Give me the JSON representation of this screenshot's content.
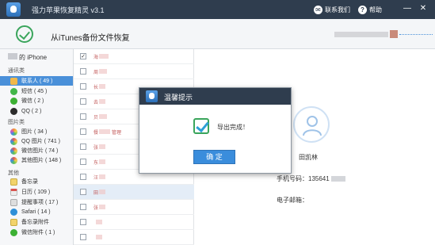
{
  "titlebar": {
    "title": "强力苹果恢复精灵 v3.1",
    "contact_label": "联系我们",
    "help_label": "帮助",
    "minimize": "—",
    "close": "✕"
  },
  "header": {
    "title": "从iTunes备份文件恢复"
  },
  "sidebar": {
    "device_label": "的 iPhone",
    "groups": {
      "contacts": "通讯类",
      "images": "图片类",
      "others": "其他"
    },
    "items": [
      {
        "label": "联系人 ( 49 )",
        "icon": "contacts-icon",
        "color": "#f0b84a"
      },
      {
        "label": "短信 ( 45 )",
        "icon": "sms-icon",
        "color": "#42b648"
      },
      {
        "label": "微信 ( 2 )",
        "icon": "wechat-icon",
        "color": "#3cb034"
      },
      {
        "label": "QQ ( 2 )",
        "icon": "qq-icon",
        "color": "#2b2b2b"
      },
      {
        "label": "图片 ( 34 )",
        "icon": "photos-icon",
        "color": "#f28c38"
      },
      {
        "label": "QQ 图片 ( 741 )",
        "icon": "qq-photos-icon",
        "color": "#e05656"
      },
      {
        "label": "微信图片 ( 74 )",
        "icon": "wechat-photos-icon",
        "color": "#e05656"
      },
      {
        "label": "其他图片 ( 148 )",
        "icon": "other-photos-icon",
        "color": "#e05656"
      },
      {
        "label": "备忘录",
        "icon": "notes-icon",
        "color": "#f2d36b"
      },
      {
        "label": "日历 ( 109 )",
        "icon": "calendar-icon",
        "color": "#ededed"
      },
      {
        "label": "提醒事项 ( 17 )",
        "icon": "reminders-icon",
        "color": "#dedede"
      },
      {
        "label": "Safari ( 14 )",
        "icon": "safari-icon",
        "color": "#2e8fd8"
      },
      {
        "label": "备忘录附件",
        "icon": "notes-attachment-icon",
        "color": "#f2d36b"
      },
      {
        "label": "微信附件 ( 1 )",
        "icon": "wechat-attachment-icon",
        "color": "#3cb034"
      }
    ]
  },
  "list": {
    "rows": [
      {
        "text": "海",
        "checked": "✓"
      },
      {
        "text": "周",
        "checked": ""
      },
      {
        "text": "长",
        "checked": ""
      },
      {
        "text": "去",
        "checked": ""
      },
      {
        "text": "贝",
        "checked": ""
      },
      {
        "text": "餐",
        "checked": ""
      },
      {
        "text": "张",
        "checked": ""
      },
      {
        "text": "东",
        "checked": ""
      },
      {
        "text": "汪",
        "checked": ""
      },
      {
        "text": "田",
        "checked": ""
      },
      {
        "text": "张",
        "checked": ""
      },
      {
        "text": "",
        "checked": ""
      },
      {
        "text": "",
        "checked": ""
      }
    ],
    "row5_suffix": "管理"
  },
  "detail": {
    "name": "田凯林",
    "phone_label": "手机号码：135641",
    "email_label": "电子邮箱："
  },
  "dialog": {
    "title": "温馨提示",
    "message": "导出完成！",
    "ok_label": "确 定"
  }
}
